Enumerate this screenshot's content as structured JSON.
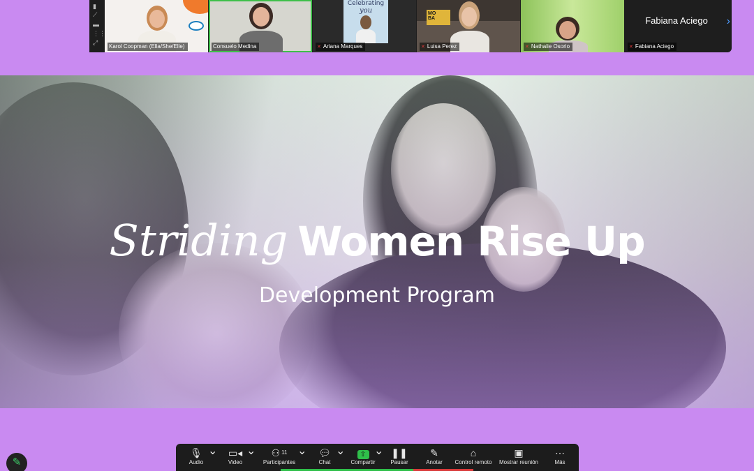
{
  "participants": [
    {
      "name": "Karol Coopman (Ella/She/Elle)",
      "muted": false,
      "icon": "video-thumbnail"
    },
    {
      "name": "Consuelo Medina",
      "muted": false,
      "active": true,
      "icon": "video-thumbnail"
    },
    {
      "name": "Ariana Marques",
      "muted": true,
      "icon": "video-thumbnail"
    },
    {
      "name": "Luisa Perez",
      "muted": true,
      "icon": "video-thumbnail"
    },
    {
      "name": "Nathalie Osorio",
      "muted": true,
      "icon": "video-thumbnail"
    },
    {
      "name": "Fabiana Aciego",
      "muted": true,
      "video_off": true,
      "display_name": "Fabiana Aciego"
    }
  ],
  "thumbnail_texts": {
    "celebrating": "Celebrating",
    "you": "you",
    "mo": "MO",
    "ba": "BA"
  },
  "slide": {
    "title_script": "Striding",
    "title_bold": "Women Rise Up",
    "subtitle": "Development Program"
  },
  "controls": {
    "audio": "Audio",
    "video": "Video",
    "participants": "Participantes",
    "participants_count": "11",
    "chat": "Chat",
    "share": "Compartir",
    "pause": "Pausar",
    "annotate": "Anotar",
    "remote_control": "Control remoto",
    "show_meeting": "Mostrar reunión",
    "more": "Más"
  },
  "colors": {
    "background": "#c98af1",
    "active_speaker": "#3fbf4a",
    "share_green": "#2fbf4a",
    "muted_red": "#e03b3b"
  }
}
